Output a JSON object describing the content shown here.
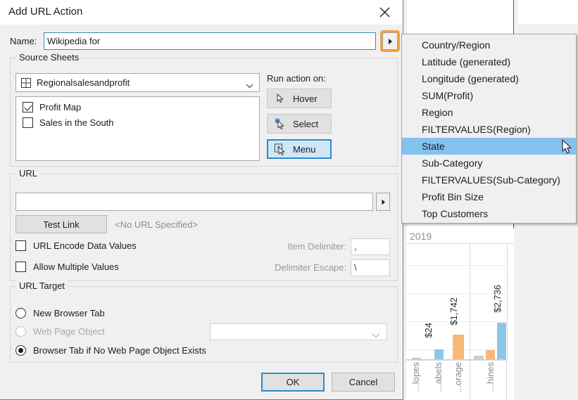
{
  "dialog": {
    "title": "Add URL Action",
    "close_icon": "close-icon",
    "name_label": "Name:",
    "name_value": "Wikipedia for",
    "name_dropdown_icon": "triangle-right-icon",
    "source_sheets": {
      "legend": "Source Sheets",
      "sheet_combo_value": "Regionalsalesandprofit",
      "sheet_combo_icon": "grid-icon",
      "sheet_combo_arrow": "chevron-down-icon",
      "items": [
        {
          "label": "Profit Map",
          "checked": true
        },
        {
          "label": "Sales in the South",
          "checked": false
        }
      ],
      "run_action_label": "Run action on:",
      "actions": [
        {
          "label": "Hover",
          "icon": "arrow-cursor-icon",
          "selected": false
        },
        {
          "label": "Select",
          "icon": "select-cursor-icon",
          "selected": false
        },
        {
          "label": "Menu",
          "icon": "menu-cursor-icon",
          "selected": true
        }
      ]
    },
    "url": {
      "legend": "URL",
      "url_value": "",
      "url_placeholder": "",
      "url_dropdown_icon": "triangle-right-icon",
      "test_link_label": "Test Link",
      "no_url_text": "<No URL Specified>",
      "encode_label": "URL Encode Data Values",
      "encode_checked": false,
      "multiple_label": "Allow Multiple Values",
      "multiple_checked": false,
      "item_delimiter_label": "Item Delimiter:",
      "item_delimiter_value": ",",
      "delimiter_escape_label": "Delimiter Escape:",
      "delimiter_escape_value": "\\"
    },
    "url_target": {
      "legend": "URL Target",
      "options": [
        {
          "label": "New Browser Tab",
          "selected": false,
          "disabled": false
        },
        {
          "label": "Web Page Object",
          "selected": false,
          "disabled": true
        },
        {
          "label": "Browser Tab if No Web Page Object Exists",
          "selected": true,
          "disabled": false
        }
      ],
      "webpage_combo_value": "",
      "webpage_combo_arrow": "chevron-down-icon"
    },
    "footer": {
      "ok_label": "OK",
      "cancel_label": "Cancel"
    }
  },
  "field_menu": {
    "items": [
      {
        "label": "Country/Region",
        "highlighted": false
      },
      {
        "label": "Latitude (generated)",
        "highlighted": false
      },
      {
        "label": "Longitude (generated)",
        "highlighted": false
      },
      {
        "label": "SUM(Profit)",
        "highlighted": false
      },
      {
        "label": "Region",
        "highlighted": false
      },
      {
        "label": "FILTERVALUES(Region)",
        "highlighted": false
      },
      {
        "label": "State",
        "highlighted": true
      },
      {
        "label": "Sub-Category",
        "highlighted": false
      },
      {
        "label": "FILTERVALUES(Sub-Category)",
        "highlighted": false
      },
      {
        "label": "Profit Bin Size",
        "highlighted": false
      },
      {
        "label": "Top Customers",
        "highlighted": false
      }
    ],
    "cursor_icon": "mouse-pointer-icon",
    "highlight_color": "#84c2ee"
  },
  "background": {
    "chart_header": "2019",
    "chart_data": {
      "type": "bar",
      "title": "2019",
      "categories": [
        "...lopes",
        "...abels",
        "...orage",
        "...hines"
      ],
      "values": [
        24,
        1742,
        2736,
        0
      ],
      "labels": [
        "$24",
        "$1,742",
        "$2,736"
      ],
      "xlabel": "",
      "ylabel": "",
      "grid": true,
      "legend_position": "none"
    }
  },
  "colors": {
    "accent_blue": "#2c8cc9",
    "highlight_orange": "#f2a33c",
    "menu_highlight": "#84c2ee",
    "bar_blue": "#8cc6e8",
    "bar_orange": "#f7b878",
    "bar_gray": "#cccccc"
  }
}
